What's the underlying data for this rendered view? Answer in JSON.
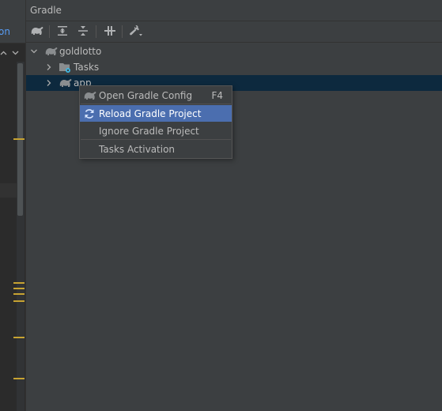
{
  "left_pane": {
    "tab_text": "on"
  },
  "panel": {
    "title": "Gradle"
  },
  "toolbar": {
    "buttons": [
      {
        "icon": "gradle-elephant-icon",
        "label": "Reload All Gradle Projects"
      },
      {
        "icon": "expand-all-icon",
        "label": "Expand All"
      },
      {
        "icon": "collapse-all-icon",
        "label": "Collapse All"
      },
      {
        "icon": "toggle-offline-icon",
        "label": "Toggle Offline Mode"
      },
      {
        "icon": "wrench-dropdown-icon",
        "label": "Build Tool Settings"
      }
    ]
  },
  "tree": {
    "root": {
      "label": "goldlotto",
      "icon": "gradle-elephant-icon"
    },
    "children": [
      {
        "label": "Tasks",
        "icon": "tasks-folder-icon"
      },
      {
        "label": "app",
        "icon": "gradle-elephant-icon"
      }
    ]
  },
  "context_menu": {
    "items": [
      {
        "label": "Open Gradle Config",
        "shortcut": "F4",
        "icon": "gradle-elephant-icon"
      },
      {
        "label": "Reload Gradle Project",
        "shortcut": "",
        "icon": "refresh-icon",
        "highlighted": true
      },
      {
        "label": "Ignore Gradle Project",
        "shortcut": ""
      },
      {
        "label": "Tasks Activation",
        "shortcut": ""
      }
    ]
  },
  "colors": {
    "panel_bg": "#3c3f41",
    "selection_row": "#0d293e",
    "menu_highlight": "#4b6eaf",
    "link_blue": "#589df6",
    "marker_yellow": "#c7a332"
  }
}
